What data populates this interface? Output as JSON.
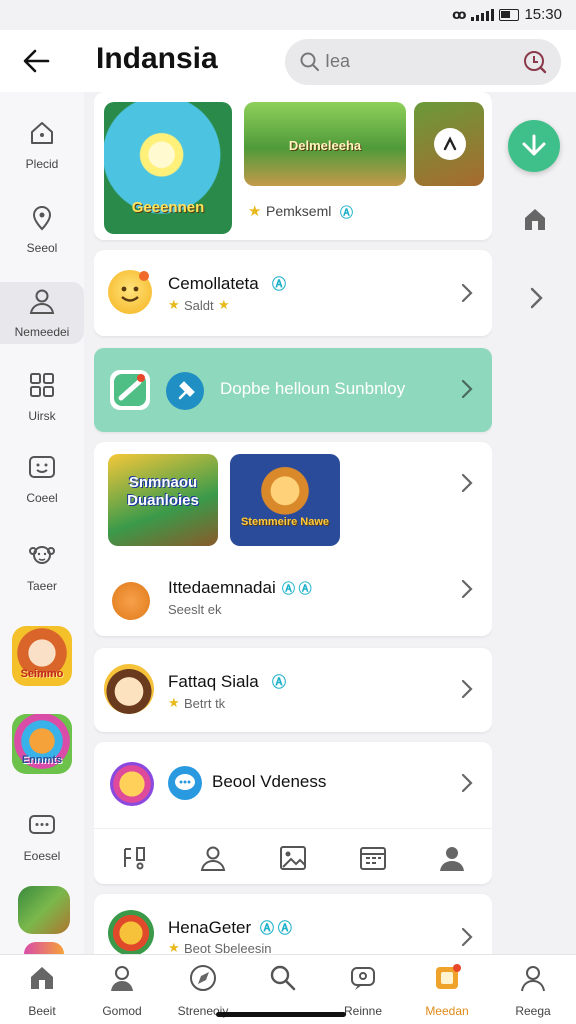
{
  "status": {
    "time": "15:30",
    "network_icon": "nfc-icon"
  },
  "header": {
    "title": "Indansia",
    "search_placeholder": "Iea"
  },
  "sidebar": {
    "items": [
      {
        "label": "Plecid",
        "icon": "home-icon"
      },
      {
        "label": "Seeol",
        "icon": "location-icon"
      },
      {
        "label": "Nemeedei",
        "icon": "person-icon"
      },
      {
        "label": "Uirsk",
        "icon": "grid-icon"
      },
      {
        "label": "Coeel",
        "icon": "smile-box-icon"
      },
      {
        "label": "Taeer",
        "icon": "monkey-icon"
      },
      {
        "label": "Eoesel",
        "icon": "chat-icon"
      }
    ],
    "game_badges": [
      "Seimmo",
      "Ennmts"
    ]
  },
  "cards": {
    "featured": {
      "tiles": [
        "Geeennen",
        "Delmeleeha",
        ""
      ],
      "caption": "Pemkseml"
    },
    "row1": {
      "title": "Cemollateta",
      "sub": "Saldt"
    },
    "highlight": {
      "label": "Dopbe helloun Sunbnloy",
      "color": "#8ed8bd"
    },
    "games": {
      "tiles": [
        "Snmnaou Duanloies",
        "Stemmeire Nawe"
      ],
      "title": "Ittedaemnadai",
      "sub": "Seeslt ek"
    },
    "row3": {
      "title": "Fattaq Siala",
      "sub": "Betrt tk"
    },
    "row4": {
      "title": "Beool Vdeness"
    },
    "row5": {
      "title": "HenaGeter",
      "sub": "Beot Sbeleesin"
    }
  },
  "tabbar": {
    "tabs": [
      {
        "label": "Beeit",
        "icon": "home-icon"
      },
      {
        "label": "Gomod",
        "icon": "person-icon"
      },
      {
        "label": "Streneoiy",
        "icon": "compass-icon"
      },
      {
        "label": "",
        "icon": "search-icon"
      },
      {
        "label": "Reinne",
        "icon": "chat-icon"
      },
      {
        "label": "Meedan",
        "icon": "wallet-icon",
        "active": true
      },
      {
        "label": "Reega",
        "icon": "profile-icon"
      }
    ]
  },
  "colors": {
    "accent": "#3fbf8a",
    "active_tab": "#e08a1a",
    "highlight": "#8ed8bd"
  }
}
